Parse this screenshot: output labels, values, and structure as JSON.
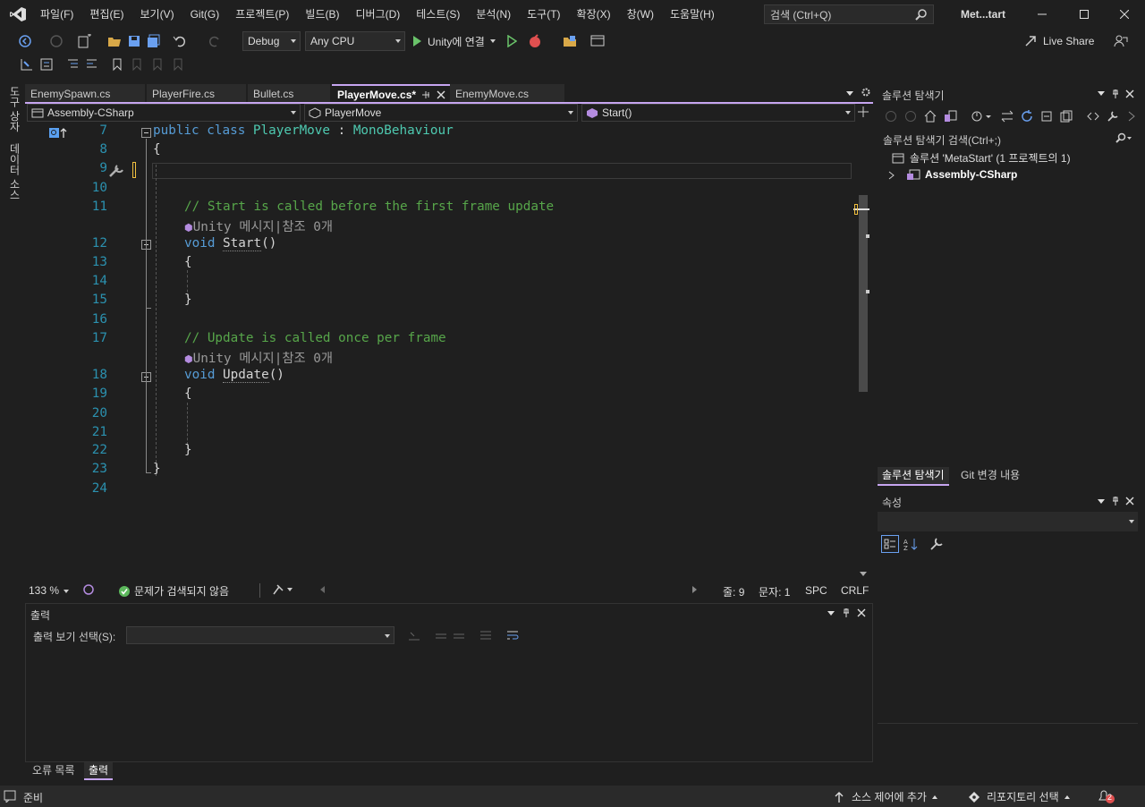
{
  "menu": [
    "파일(F)",
    "편집(E)",
    "보기(V)",
    "Git(G)",
    "프로젝트(P)",
    "빌드(B)",
    "디버그(D)",
    "테스트(S)",
    "분석(N)",
    "도구(T)",
    "확장(X)",
    "창(W)",
    "도움말(H)"
  ],
  "search": {
    "placeholder": "검색 (Ctrl+Q)"
  },
  "solution_title": "Met...tart",
  "toolbar": {
    "config": "Debug",
    "platform": "Any CPU",
    "run_label": "Unity에 연결",
    "live_share": "Live Share"
  },
  "left_rail": {
    "toolbox": "도구 상자",
    "data_sources": "데이터 소스"
  },
  "tabs": [
    {
      "label": "EnemySpawn.cs"
    },
    {
      "label": "PlayerFire.cs"
    },
    {
      "label": "Bullet.cs"
    },
    {
      "label": "PlayerMove.cs*"
    },
    {
      "label": "EnemyMove.cs"
    }
  ],
  "nav": {
    "project": "Assembly-CSharp",
    "class": "PlayerMove",
    "member": "Start()"
  },
  "code": {
    "line_numbers": [
      "7",
      "8",
      "9",
      "10",
      "11",
      "12",
      "13",
      "14",
      "15",
      "16",
      "17",
      "18",
      "19",
      "20",
      "21",
      "22",
      "23",
      "24"
    ],
    "l7_kw1": "public",
    "l7_kw2": "class",
    "l7_name": "PlayerMove",
    "l7_colon": ":",
    "l7_base": "MonoBehaviour",
    "brace_open": "{",
    "brace_close": "}",
    "comment1": "// Start is called before the first frame update",
    "lens1": "Unity 메시지|참조 0개",
    "void": "void",
    "start_name": "Start",
    "parens": "()",
    "comment2": "// Update is called once per frame",
    "lens2": "Unity 메시지|참조 0개",
    "update_name": "Update"
  },
  "editor_status": {
    "zoom": "133 %",
    "issues": "문제가 검색되지 않음",
    "line": "줄: 9",
    "col": "문자: 1",
    "spc": "SPC",
    "crlf": "CRLF"
  },
  "output": {
    "title": "출력",
    "select_label": "출력 보기 선택(S):"
  },
  "bottom_tabs": [
    "오류 목록",
    "출력"
  ],
  "solution_explorer": {
    "title": "솔루션 탐색기",
    "search": "솔루션 탐색기 검색(Ctrl+;)",
    "solution": "솔루션 'MetaStart' (1 프로젝트의 1)",
    "project": "Assembly-CSharp",
    "tab1": "솔루션 탐색기",
    "tab2": "Git 변경 내용"
  },
  "properties": {
    "title": "속성"
  },
  "status": {
    "ready": "준비",
    "source_control": "소스 제어에 추가",
    "repo": "리포지토리 선택",
    "notif_count": "2"
  },
  "colors": {
    "accent": "#c6a5f0",
    "line_number": "#2b91af",
    "keyword": "#569cd6",
    "type": "#4ec9b0",
    "comment": "#57a64a"
  }
}
